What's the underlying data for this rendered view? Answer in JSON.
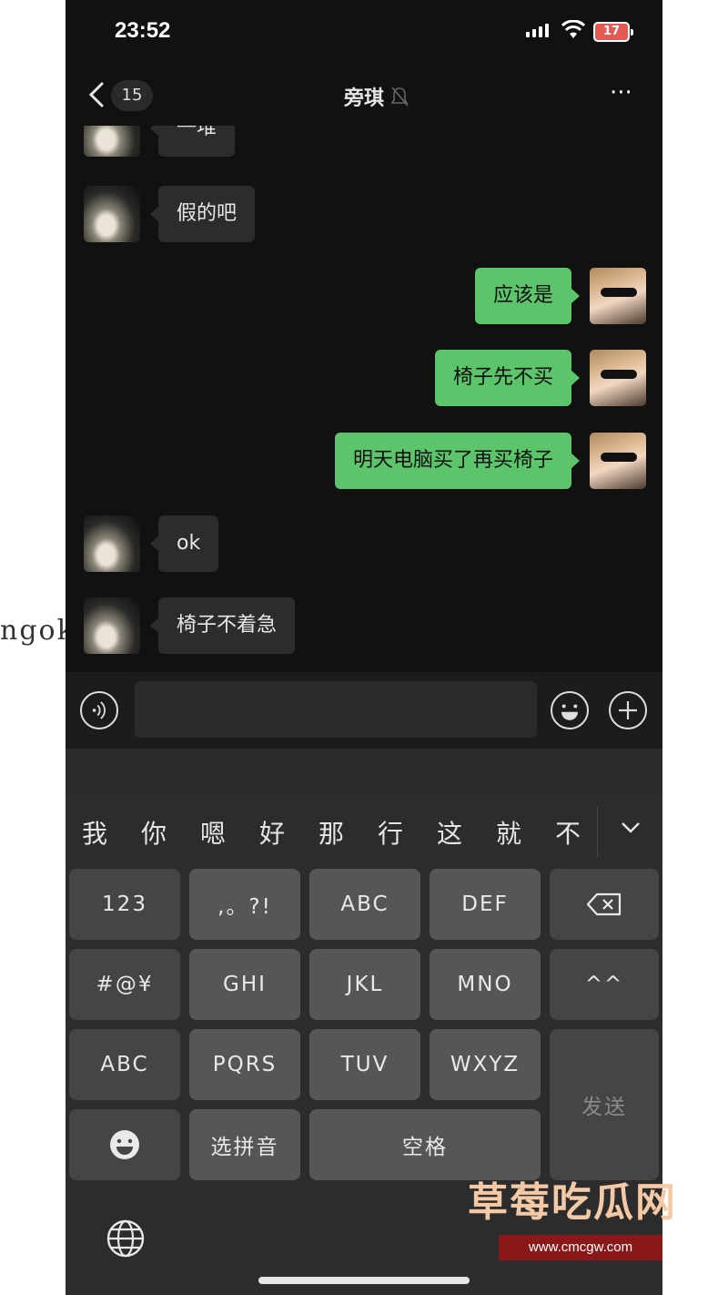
{
  "side_watermark": "ngok.cc",
  "status_bar": {
    "time": "23:52",
    "battery": "17"
  },
  "nav": {
    "back_count": "15",
    "title": "旁琪",
    "more": "···"
  },
  "messages": [
    {
      "side": "in",
      "text": "一堆"
    },
    {
      "side": "in",
      "text": "假的吧"
    },
    {
      "side": "out",
      "text": "应该是"
    },
    {
      "side": "out",
      "text": "椅子先不买"
    },
    {
      "side": "out",
      "text": "明天电脑买了再买椅子"
    },
    {
      "side": "in",
      "text": "ok"
    },
    {
      "side": "in",
      "text": "椅子不着急"
    }
  ],
  "input": {
    "value": ""
  },
  "keyboard": {
    "candidates": [
      "我",
      "你",
      "嗯",
      "好",
      "那",
      "行",
      "这",
      "就",
      "不"
    ],
    "keys": {
      "num": "123",
      "punct": ",。?!",
      "abc": "ABC",
      "def": "DEF",
      "ghi": "GHI",
      "jkl": "JKL",
      "mno": "MNO",
      "symbols": "#@¥",
      "face": "^^",
      "abc2": "ABC",
      "pqrs": "PQRS",
      "tuv": "TUV",
      "wxyz": "WXYZ",
      "send": "发送",
      "pinyin": "选拼音",
      "space": "空格"
    }
  },
  "watermark": {
    "title": "草莓吃瓜网",
    "url": "www.cmcgw.com"
  }
}
